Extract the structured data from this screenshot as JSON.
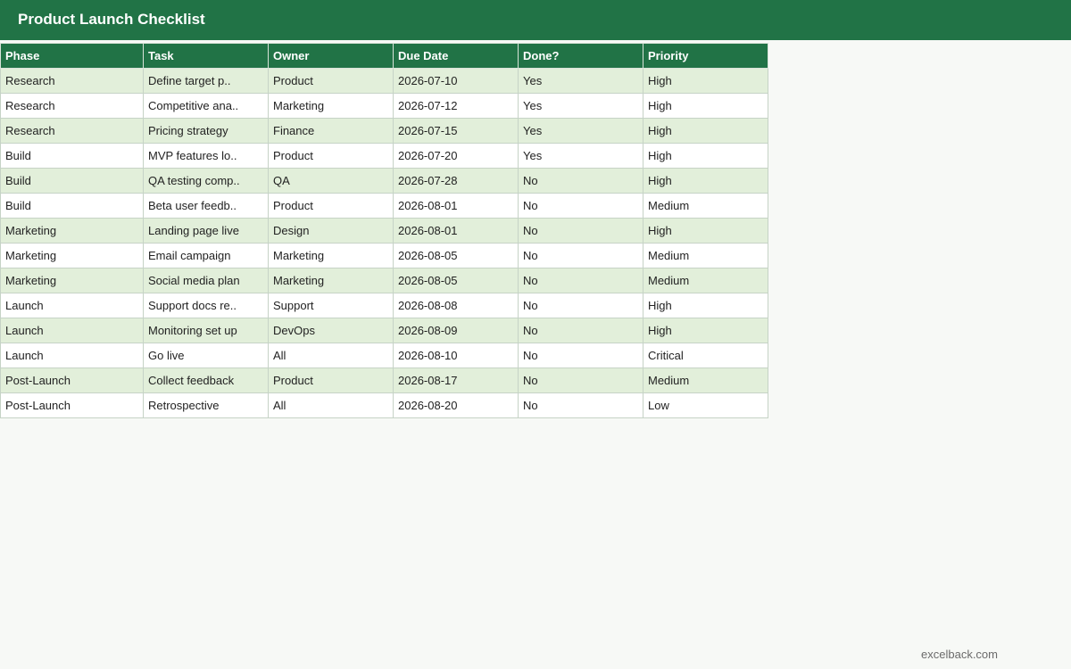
{
  "title": "Product Launch Checklist",
  "columns": [
    "Phase",
    "Task",
    "Owner",
    "Due Date",
    "Done?",
    "Priority"
  ],
  "rows": [
    [
      "Research",
      "Define target p..",
      "Product",
      "2026-07-10",
      "Yes",
      "High"
    ],
    [
      "Research",
      "Competitive ana..",
      "Marketing",
      "2026-07-12",
      "Yes",
      "High"
    ],
    [
      "Research",
      "Pricing strategy",
      "Finance",
      "2026-07-15",
      "Yes",
      "High"
    ],
    [
      "Build",
      "MVP features lo..",
      "Product",
      "2026-07-20",
      "Yes",
      "High"
    ],
    [
      "Build",
      "QA testing comp..",
      "QA",
      "2026-07-28",
      "No",
      "High"
    ],
    [
      "Build",
      "Beta user feedb..",
      "Product",
      "2026-08-01",
      "No",
      "Medium"
    ],
    [
      "Marketing",
      "Landing page live",
      "Design",
      "2026-08-01",
      "No",
      "High"
    ],
    [
      "Marketing",
      "Email campaign",
      "Marketing",
      "2026-08-05",
      "No",
      "Medium"
    ],
    [
      "Marketing",
      "Social media plan",
      "Marketing",
      "2026-08-05",
      "No",
      "Medium"
    ],
    [
      "Launch",
      "Support docs re..",
      "Support",
      "2026-08-08",
      "No",
      "High"
    ],
    [
      "Launch",
      "Monitoring set up",
      "DevOps",
      "2026-08-09",
      "No",
      "High"
    ],
    [
      "Launch",
      "Go live",
      "All",
      "2026-08-10",
      "No",
      "Critical"
    ],
    [
      "Post-Launch",
      "Collect feedback",
      "Product",
      "2026-08-17",
      "No",
      "Medium"
    ],
    [
      "Post-Launch",
      "Retrospective",
      "All",
      "2026-08-20",
      "No",
      "Low"
    ]
  ],
  "footer": "excelback.com",
  "colors": {
    "header_bg": "#217346",
    "band_row": "#e2efda",
    "plain_row": "#ffffff"
  }
}
